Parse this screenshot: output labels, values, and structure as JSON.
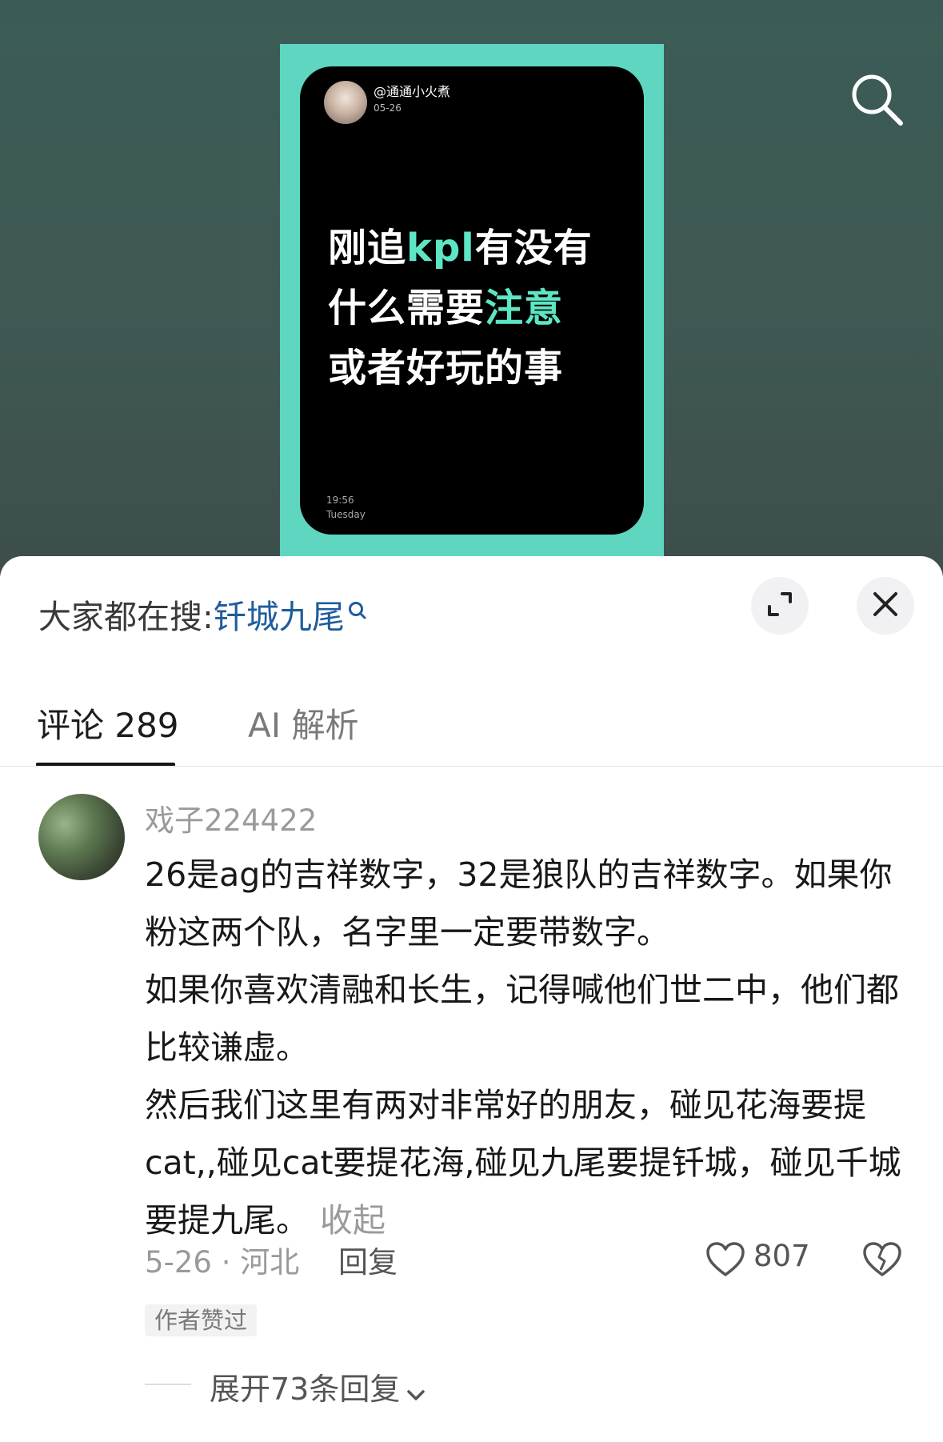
{
  "video": {
    "author": "@通通小火煮",
    "date": "05-26",
    "headline": {
      "line1_pre": "刚追",
      "line1_highlight": "kpl",
      "line1_post": "有没有",
      "line2_pre": "什么需要",
      "line2_highlight": "注意",
      "line3": "或者好玩的事"
    },
    "time": "19:56",
    "day": "Tuesday",
    "frame_color": "#5ed6c0",
    "highlight_color": "#5ee6c4"
  },
  "sheet": {
    "hot_search_label": "大家都在搜:",
    "hot_search_term": "钎城九尾"
  },
  "tabs": [
    {
      "label": "评论 289",
      "active": true
    },
    {
      "label": "AI 解析",
      "active": false
    }
  ],
  "comment": {
    "username": "戏子224422",
    "lines": [
      "26是ag的吉祥数字，32是狼队的吉祥数字。如果你粉这两个队，名字里一定要带数字。",
      "如果你喜欢清融和长生，记得喊他们世二中，他们都比较谦虚。",
      "然后我们这里有两对非常好的朋友，碰见花海要提cat,,碰见cat要提花海,碰见九尾要提钎城，碰见千城要提九尾。"
    ],
    "collapse_label": "收起",
    "meta": "5-26 · 河北",
    "reply_label": "回复",
    "like_count": "807",
    "author_liked": "作者赞过",
    "expand_replies": "展开73条回复"
  }
}
